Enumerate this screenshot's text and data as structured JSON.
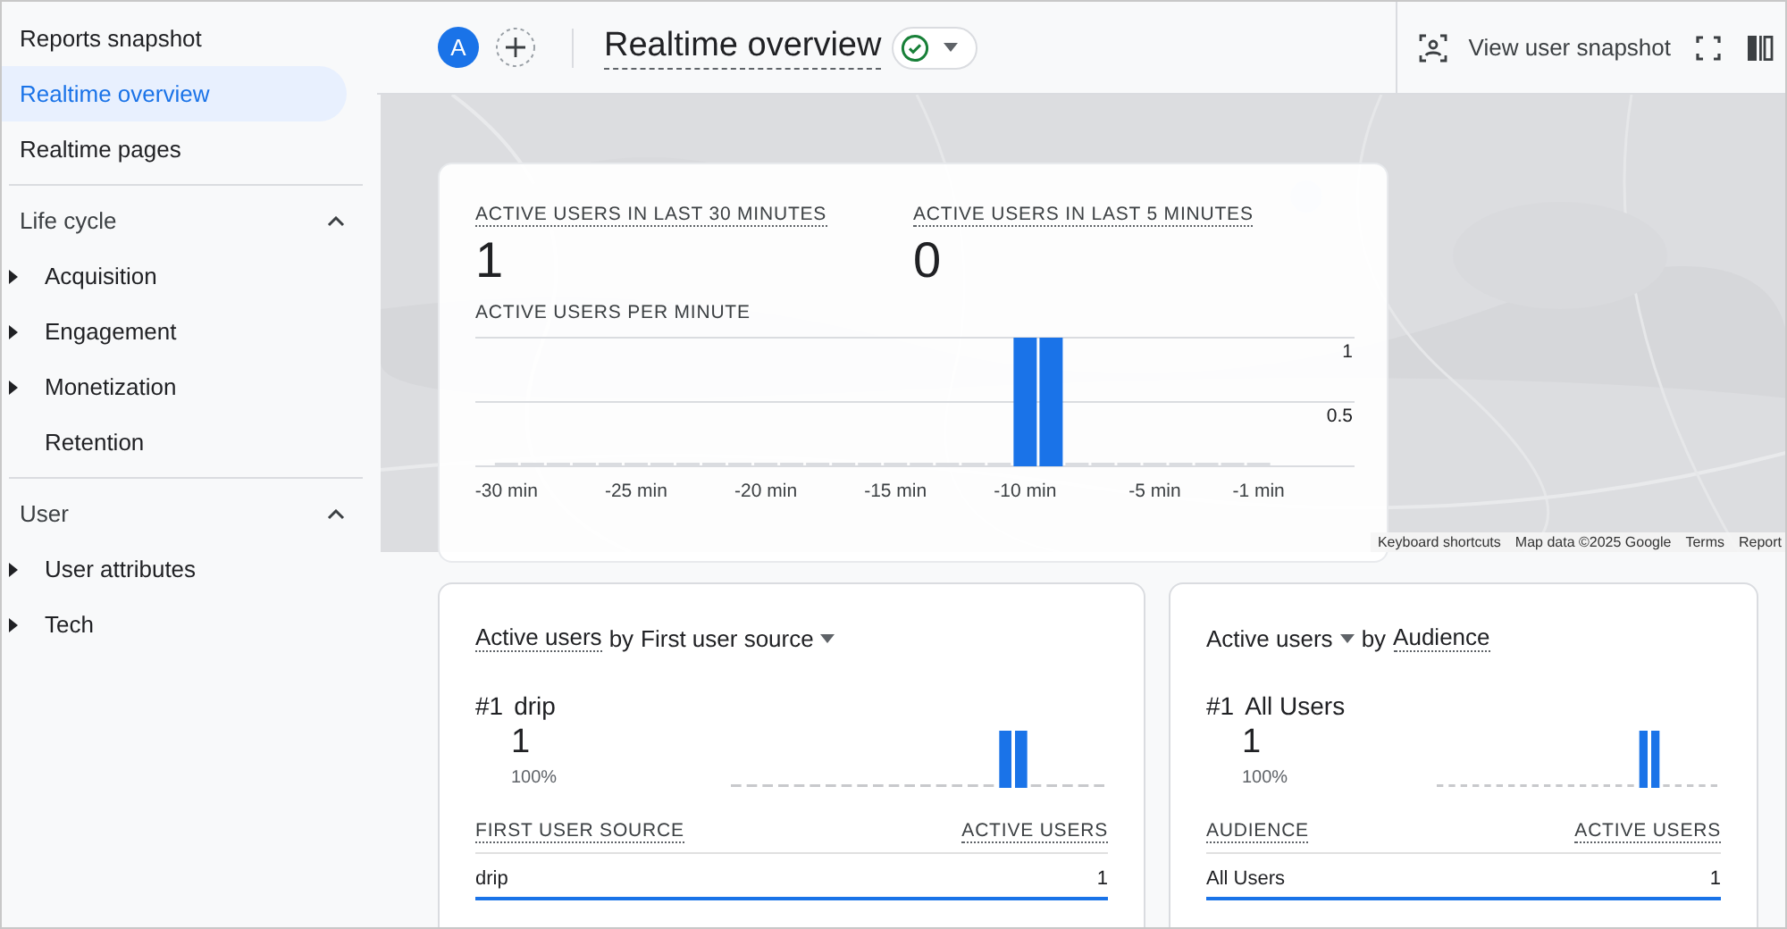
{
  "sidebar": {
    "items": [
      {
        "label": "Reports snapshot",
        "selected": false
      },
      {
        "label": "Realtime overview",
        "selected": true
      },
      {
        "label": "Realtime pages",
        "selected": false
      }
    ],
    "sections": [
      {
        "title": "Life cycle",
        "expanded": true,
        "items": [
          {
            "label": "Acquisition",
            "has_children": true
          },
          {
            "label": "Engagement",
            "has_children": true
          },
          {
            "label": "Monetization",
            "has_children": true
          },
          {
            "label": "Retention",
            "has_children": false
          }
        ]
      },
      {
        "title": "User",
        "expanded": true,
        "items": [
          {
            "label": "User attributes",
            "has_children": true
          },
          {
            "label": "Tech",
            "has_children": true
          }
        ]
      }
    ]
  },
  "header": {
    "avatar": "A",
    "title": "Realtime overview",
    "verified": true,
    "actions": [
      {
        "kind": "snapshot",
        "label": "View user snapshot"
      },
      {
        "kind": "fullscreen"
      },
      {
        "kind": "split"
      }
    ]
  },
  "map": {
    "kind": "picture",
    "attribution": [
      "Keyboard shortcuts",
      "Map data ©2025 Google",
      "Terms",
      "Report"
    ]
  },
  "overview": {
    "stats": [
      {
        "label": "ACTIVE USERS IN LAST 30 MINUTES",
        "value": "1"
      },
      {
        "label": "ACTIVE USERS IN LAST 5 MINUTES",
        "value": "0"
      }
    ],
    "chart_title": "ACTIVE USERS PER MINUTE",
    "chart_data": {
      "type": "bar",
      "x": [
        -30,
        -29,
        -28,
        -27,
        -26,
        -25,
        -24,
        -23,
        -22,
        -21,
        -20,
        -19,
        -18,
        -17,
        -16,
        -15,
        -14,
        -13,
        -12,
        -11,
        -10,
        -9,
        -8,
        -7,
        -6,
        -5,
        -4,
        -3,
        -2,
        -1
      ],
      "values": [
        0,
        0,
        0,
        0,
        0,
        0,
        0,
        0,
        0,
        0,
        0,
        0,
        0,
        0,
        0,
        0,
        0,
        0,
        0,
        0,
        1,
        1,
        0,
        0,
        0,
        0,
        0,
        0,
        0,
        0
      ],
      "xlim": [
        -31.2,
        2.7
      ],
      "ylim": [
        -0.75,
        2.36
      ],
      "yticks": [
        0.5,
        1
      ],
      "xticks": [
        {
          "value": -30,
          "label": "-30 min"
        },
        {
          "value": -25,
          "label": "-25 min"
        },
        {
          "value": -20,
          "label": "-20 min"
        },
        {
          "value": -15,
          "label": "-15 min"
        },
        {
          "value": -10,
          "label": "-10 min"
        },
        {
          "value": -5,
          "label": "-5 min"
        },
        {
          "value": -1,
          "label": "-1 min"
        }
      ]
    }
  },
  "cards": [
    {
      "title": [
        {
          "text": "Active users",
          "kind": "dotted"
        },
        {
          "text": "by",
          "kind": "plain"
        },
        {
          "text": "First user source",
          "kind": "plain"
        },
        {
          "kind": "caret"
        }
      ],
      "rank": "#1",
      "top_item": "drip",
      "value": "1",
      "share": "100%",
      "columns": [
        "FIRST USER SOURCE",
        "ACTIVE USERS"
      ],
      "rows": [
        {
          "name": "drip",
          "value": "1"
        }
      ]
    },
    {
      "title": [
        {
          "text": "Active users",
          "kind": "plain"
        },
        {
          "kind": "caret"
        },
        {
          "text": "by",
          "kind": "plain"
        },
        {
          "text": "Audience",
          "kind": "dotted"
        }
      ],
      "rank": "#1",
      "top_item": "All Users",
      "value": "1",
      "share": "100%",
      "columns": [
        "AUDIENCE",
        "ACTIVE USERS"
      ],
      "rows": [
        {
          "name": "All Users",
          "value": "1"
        }
      ]
    }
  ]
}
